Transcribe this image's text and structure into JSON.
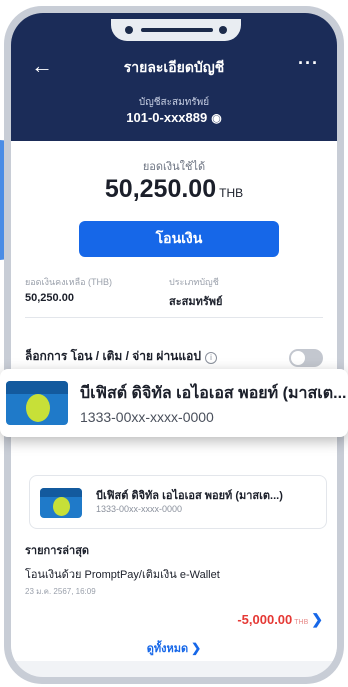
{
  "header": {
    "title": "รายละเอียดบัญชี",
    "account_type": "บัญชีสะสมทรัพย์",
    "account_number": "101-0-xxx889",
    "back_icon": "arrow-left-icon",
    "more_icon": "more-dots-icon"
  },
  "balance": {
    "available_label": "ยอดเงินใช้ได้",
    "available_amount": "50,250.00",
    "currency": "THB",
    "transfer_button": "โอนเงิน",
    "remaining_label": "ยอดเงินคงเหลือ (THB)",
    "remaining_value": "50,250.00",
    "type_label": "ประเภทบัญชี",
    "type_value": "สะสมทรัพย์"
  },
  "lock": {
    "label": "ล็อกการ โอน / เติม / จ่าย ผ่านแอป",
    "enabled": false
  },
  "popup_card": {
    "name": "บีเฟิสต์ ดิจิทัล เอไอเอส พอยท์ (มาสเต...",
    "number": "1333-00xx-xxxx-0000"
  },
  "linked_card": {
    "name": "บีเฟิสต์ ดิจิทัล เอไอเอส พอยท์ (มาสเต...)",
    "number": "1333-00xx-xxxx-0000"
  },
  "recent": {
    "title": "รายการล่าสุด",
    "items": [
      {
        "description": "โอนเงินด้วย PromptPay/เติมเงิน e-Wallet",
        "date": "23 ม.ค. 2567, 16:09",
        "amount": "-5,000.00",
        "currency": "THB"
      }
    ],
    "see_all": "ดูทั้งหมด"
  },
  "colors": {
    "header_bg": "#1b2c58",
    "accent": "#1667e8",
    "negative": "#e53935"
  }
}
